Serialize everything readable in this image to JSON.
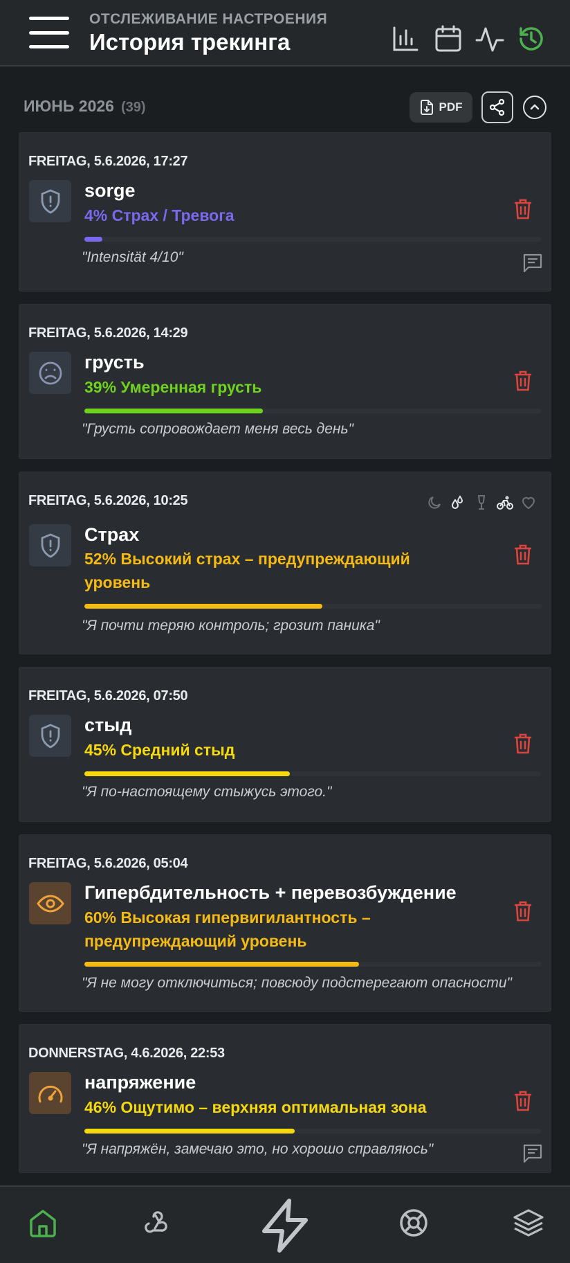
{
  "header": {
    "subtitle": "ОТСЛЕЖИВАНИЕ НАСТРОЕНИЯ",
    "title": "История трекинга",
    "icons": [
      "bar-chart-icon",
      "calendar-icon",
      "activity-icon",
      "history-icon"
    ],
    "active_color": "#4caf50"
  },
  "month": {
    "label": "ИЮНЬ 2026",
    "count": "(39)",
    "pdf_label": "PDF"
  },
  "entries": [
    {
      "date": "FREITAG, 5.6.2026, 17:27",
      "icon": "shield-alert-icon",
      "name": "sorge",
      "level": "4% Страх / Тревога",
      "percent": 4,
      "color": "#7b68ee",
      "quote": "\"Intensität 4/10\"",
      "has_note": true
    },
    {
      "date": "FREITAG, 5.6.2026, 14:29",
      "icon": "sad-face-icon",
      "name": "грусть",
      "level": "39% Умеренная грусть",
      "percent": 39,
      "color": "#6fd21e",
      "quote": "\"Грусть сопровождает меня весь день\"",
      "has_note": false
    },
    {
      "date": "FREITAG, 5.6.2026, 10:25",
      "icon": "shield-alert-icon",
      "name": "Страх",
      "level": "52% Высокий страх – предупреждающий уровень",
      "percent": 52,
      "color": "#f5bb14",
      "quote": "\"Я почти теряю контроль; грозит паника\"",
      "has_note": false,
      "trackers": [
        "moon-icon",
        "drops-icon",
        "wine-glass-icon",
        "bicycle-icon",
        "heart-icon"
      ]
    },
    {
      "date": "FREITAG, 5.6.2026, 07:50",
      "icon": "shield-alert-icon",
      "name": "стыд",
      "level": "45% Средний стыд",
      "percent": 45,
      "color": "#f5d80e",
      "quote": "\"Я по-настоящему стыжусь этого.\"",
      "has_note": false
    },
    {
      "date": "FREITAG, 5.6.2026, 05:04",
      "icon": "eye-icon",
      "name": "Гипербдительность + перевозбуждение",
      "level": "60% Высокая гипервигилантность – предупреждающий уровень",
      "percent": 60,
      "color": "#f5bb14",
      "quote": "\"Я не могу отключиться; повсюду подстерегают опасности\"",
      "has_note": false
    },
    {
      "date": "DONNERSTAG, 4.6.2026, 22:53",
      "icon": "gauge-icon",
      "name": "напряжение",
      "level": "46% Ощутимо – верхняя оптимальная зона",
      "percent": 46,
      "color": "#f5d80e",
      "quote": "\"Я напряжён, замечаю это, но хорошо справляюсь\"",
      "has_note": true
    }
  ],
  "bottom_nav": [
    "home-icon",
    "webhook-icon",
    "lightning-icon",
    "lifebuoy-icon",
    "layers-icon"
  ]
}
